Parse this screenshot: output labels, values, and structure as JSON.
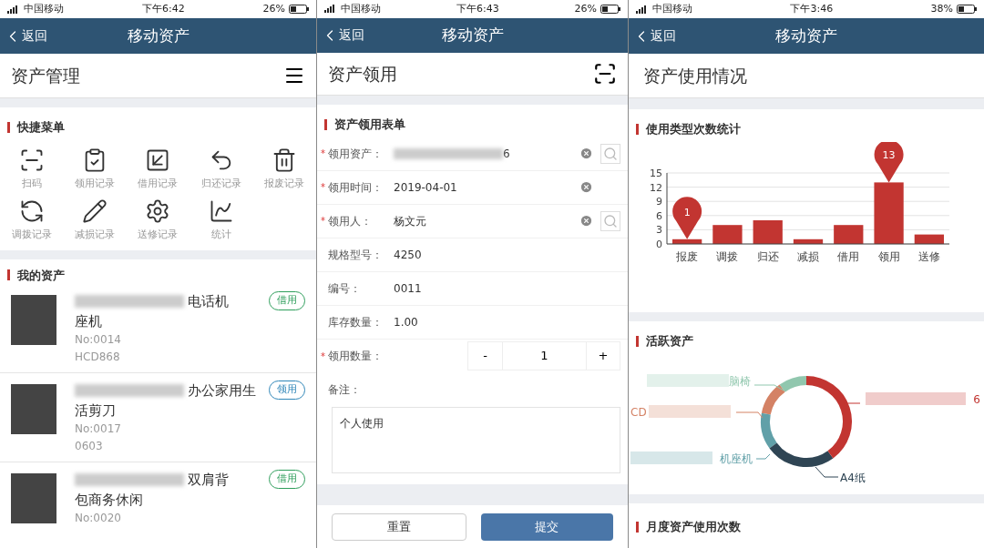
{
  "screens": [
    {
      "kind": "asset_home",
      "status_bar": {
        "carrier": "中国移动",
        "time": "下午6:42",
        "battery": "26%"
      },
      "nav": {
        "back": "返回",
        "title": "移动资产"
      },
      "header": {
        "title": "资产管理"
      },
      "quick_menu": {
        "heading": "快捷菜单",
        "items": [
          "扫码",
          "领用记录",
          "借用记录",
          "归还记录",
          "报废记录",
          "调拨记录",
          "减损记录",
          "送修记录",
          "统计"
        ]
      },
      "my_assets": {
        "heading": "我的资产",
        "items": [
          {
            "name_lines": [
              "电话机",
              "座机"
            ],
            "no": "No:0014",
            "code": "HCD868",
            "tag": "借用",
            "color": "#2e9e5b"
          },
          {
            "name_lines": [
              "办公家用生",
              "活剪刀"
            ],
            "no": "No:0017",
            "code": "0603",
            "tag": "领用",
            "color": "#2f86b8"
          },
          {
            "name_lines": [
              "双肩背",
              "包商务休闲"
            ],
            "no": "No:0020",
            "tag": "借用",
            "color": "#2e9e5b"
          }
        ]
      }
    },
    {
      "kind": "asset_form",
      "status_bar": {
        "carrier": "中国移动",
        "time": "下午6:43",
        "battery": "26%"
      },
      "nav": {
        "back": "返回",
        "title": "移动资产"
      },
      "header": {
        "title": "资产领用"
      },
      "form": {
        "heading": "资产领用表单",
        "required_mark": "*",
        "fields": [
          {
            "kind": "text",
            "label": "领用资产：",
            "value": "6",
            "required": true,
            "clearable": true,
            "lookup": true,
            "redacted": true
          },
          {
            "kind": "text",
            "label": "领用时间：",
            "value": "2019-04-01",
            "required": true,
            "clearable": true,
            "lookup": false,
            "redacted": false
          },
          {
            "kind": "text",
            "label": "领用人：",
            "value": "杨文元",
            "required": true,
            "clearable": true,
            "lookup": true,
            "redacted": false
          },
          {
            "kind": "text",
            "label": "规格型号：",
            "value": "4250",
            "required": false,
            "clearable": false,
            "lookup": false,
            "redacted": false
          },
          {
            "kind": "text",
            "label": "编号：",
            "value": "0011",
            "required": false,
            "clearable": false,
            "lookup": false,
            "redacted": false
          },
          {
            "kind": "text",
            "label": "库存数量：",
            "value": "1.00",
            "required": false,
            "clearable": false,
            "lookup": false,
            "redacted": false
          },
          {
            "kind": "stepper",
            "label": "领用数量：",
            "value": "1",
            "minus": "-",
            "plus": "+",
            "required": true
          },
          {
            "kind": "textarea",
            "label": "备注：",
            "value": "个人使用",
            "required": false
          }
        ]
      },
      "buttons": [
        {
          "label": "重置",
          "primary": false
        },
        {
          "label": "提交",
          "primary": true
        }
      ]
    },
    {
      "kind": "usage_stats",
      "status_bar": {
        "carrier": "中国移动",
        "time": "下午3:46",
        "battery": "38%"
      },
      "nav": {
        "back": "返回",
        "title": "移动资产"
      },
      "header": {
        "title": "资产使用情况"
      },
      "usage_chart": {
        "heading": "使用类型次数统计",
        "chart_data": {
          "type": "bar",
          "categories": [
            "报废",
            "调拨",
            "归还",
            "减损",
            "借用",
            "领用",
            "送修"
          ],
          "values": [
            1,
            4,
            5,
            1,
            4,
            13,
            2
          ],
          "ylim": [
            0,
            15
          ],
          "yticks": [
            0,
            3,
            6,
            9,
            12,
            15
          ],
          "grid": true,
          "annotations": [
            {
              "x": "报废",
              "y": 1,
              "text": "1"
            },
            {
              "x": "领用",
              "y": 13,
              "text": "13"
            }
          ]
        }
      },
      "active_assets": {
        "heading": "活跃资产",
        "items": [
          {
            "label": "脑椅",
            "color": "#91c7ae"
          },
          {
            "label": "CD",
            "color": "#d48265"
          },
          {
            "label": "机座机",
            "color": "#61a0a8"
          },
          {
            "label": "A4纸",
            "color": "#2f4554"
          },
          {
            "label": "6",
            "color": "#c23531"
          }
        ]
      },
      "monthly": {
        "heading": "月度资产使用次数"
      }
    }
  ]
}
